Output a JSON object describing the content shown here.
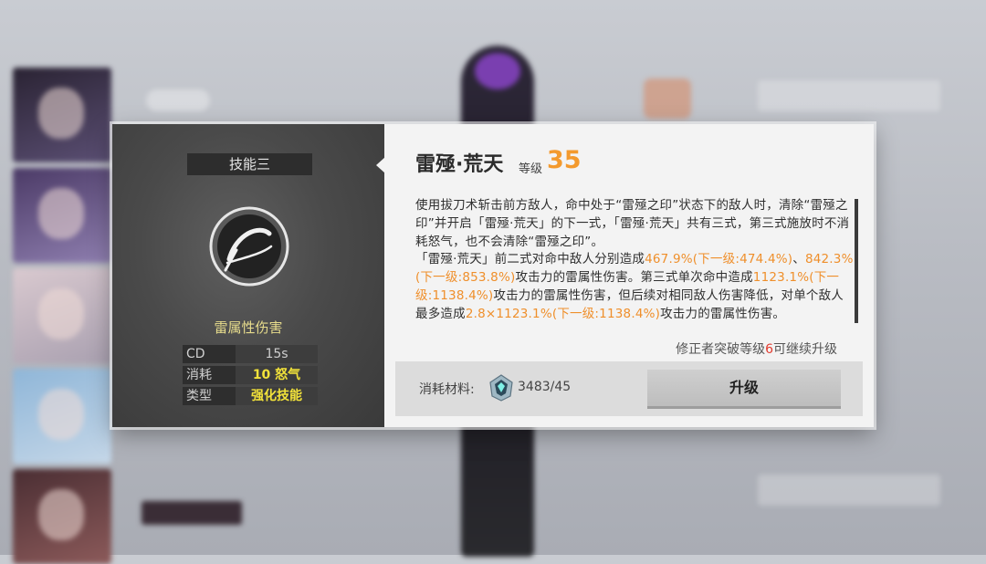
{
  "skill": {
    "slot_label": "技能三",
    "name": "雷殛·荒天",
    "level_label": "等级",
    "level": "35",
    "damage_type": "雷属性伤害",
    "icon": "slash-circle-icon"
  },
  "stats": [
    {
      "key": "CD",
      "value": "15s"
    },
    {
      "key": "消耗",
      "value": "10 怒气"
    },
    {
      "key": "类型",
      "value": "强化技能"
    }
  ],
  "description": {
    "para1": "使用拔刀术斩击前方敌人，命中处于“雷殛之印”状态下的敌人时，清除“雷殛之印”并开启「雷殛·荒天」的下一式，「雷殛·荒天」共有三式，第三式施放时不消耗怒气，也不会清除“雷殛之印”。",
    "para2_a": "「雷殛·荒天」前二式对命中敌人分别造成",
    "para2_v1": "467.9%(下一级:474.4%)",
    "para2_b": "、",
    "para2_v2": "842.3%(下一级:853.8%)",
    "para2_c": "攻击力的雷属性伤害。第三式单次命中造成",
    "para2_v3": "1123.1%(下一级:1138.4%)",
    "para2_d": "攻击力的雷属性伤害，但后续对相同敌人伤害降低，对单个敌人最多造成",
    "para2_v4": "2.8×1123.1%(下一级:1138.4%)",
    "para2_e": "攻击力的雷属性伤害。"
  },
  "hint": {
    "prefix": "修正者突破等级",
    "level": "6",
    "suffix": "可继续升级"
  },
  "materials": {
    "label": "消耗材料:",
    "icon": "crystal-material-icon",
    "count": "3483/45"
  },
  "upgrade_button": "升级",
  "colors": {
    "accent_orange": "#f39a2e",
    "highlight_yellow": "#f2e23a",
    "damage_type_gold": "#e7dc8c",
    "warn_red": "#e23a2e"
  }
}
